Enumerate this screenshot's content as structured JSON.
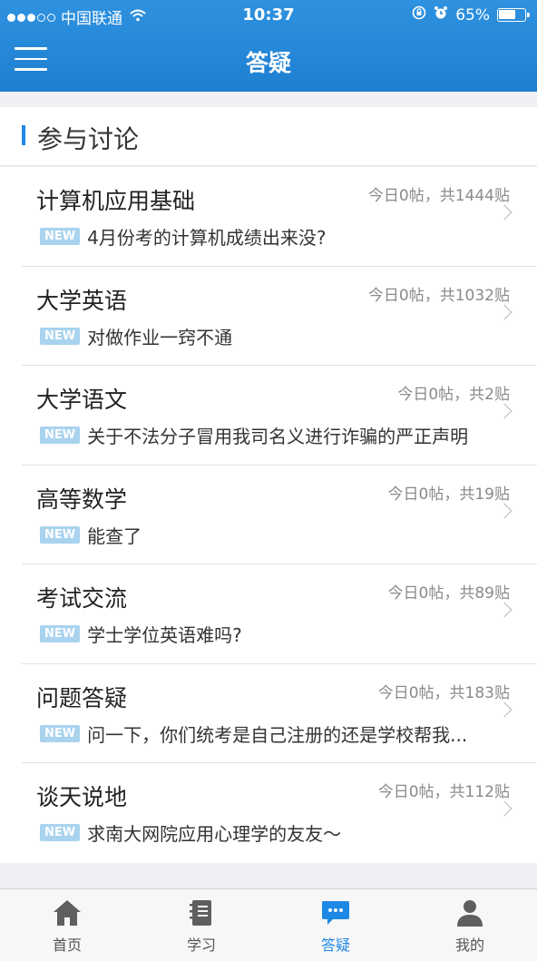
{
  "status_bar": {
    "carrier": "中国联通",
    "time": "10:37",
    "battery_percent": 65,
    "battery_text": "65%"
  },
  "header": {
    "title": "答疑",
    "menu_icon": "hamburger-menu-icon"
  },
  "section": {
    "title": "参与讨论"
  },
  "forums": [
    {
      "name": "计算机应用基础",
      "stats": "今日0帖，共1444贴",
      "badge": "NEW",
      "latest": "4月份考的计算机成绩出来没?"
    },
    {
      "name": "大学英语",
      "stats": "今日0帖，共1032贴",
      "badge": "NEW",
      "latest": "对做作业一窍不通"
    },
    {
      "name": "大学语文",
      "stats": "今日0帖，共2贴",
      "badge": "NEW",
      "latest": "关于不法分子冒用我司名义进行诈骗的严正声明"
    },
    {
      "name": "高等数学",
      "stats": "今日0帖，共19贴",
      "badge": "NEW",
      "latest": "能查了"
    },
    {
      "name": "考试交流",
      "stats": "今日0帖，共89贴",
      "badge": "NEW",
      "latest": "学士学位英语难吗?"
    },
    {
      "name": "问题答疑",
      "stats": "今日0帖，共183贴",
      "badge": "NEW",
      "latest": "问一下，你们统考是自己注册的还是学校帮我..."
    },
    {
      "name": "谈天说地",
      "stats": "今日0帖，共112贴",
      "badge": "NEW",
      "latest": "求南大网院应用心理学的友友～"
    }
  ],
  "tabs": [
    {
      "label": "首页",
      "icon": "home-icon",
      "active": false
    },
    {
      "label": "学习",
      "icon": "notebook-icon",
      "active": false
    },
    {
      "label": "答疑",
      "icon": "chat-bubble-icon",
      "active": true
    },
    {
      "label": "我的",
      "icon": "person-icon",
      "active": false
    }
  ],
  "colors": {
    "header_blue": "#1e88e5",
    "badge_blue": "#a9d3ee",
    "inactive_icon": "#5f5f5f"
  }
}
